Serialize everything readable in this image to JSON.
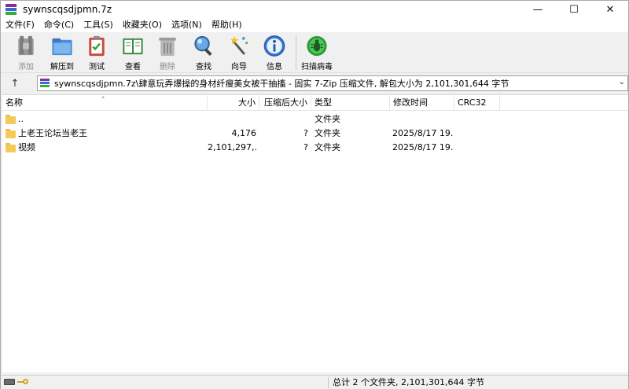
{
  "window": {
    "title": "sywnscqsdjpmn.7z",
    "minimize_glyph": "—",
    "maximize_glyph": "☐",
    "close_glyph": "✕"
  },
  "menu": [
    "文件(F)",
    "命令(C)",
    "工具(S)",
    "收藏夹(O)",
    "选项(N)",
    "帮助(H)"
  ],
  "toolbar": {
    "add": "添加",
    "extract": "解压到",
    "test": "测试",
    "view": "查看",
    "delete": "删除",
    "find": "查找",
    "wizard": "向导",
    "info": "信息",
    "scan": "扫描病毒"
  },
  "address": {
    "up_glyph": "↑",
    "path": "sywnscqsdjpmn.7z\\肆意玩弄爆操的身材纤瘦美女被干抽搐 - 固实 7-Zip 压缩文件, 解包大小为 2,101,301,644 字节",
    "dropdown_glyph": "⌄"
  },
  "columns": {
    "name": "名称",
    "size": "大小",
    "packed": "压缩后大小",
    "type": "类型",
    "modified": "修改时间",
    "crc": "CRC32"
  },
  "sort_caret": "˄",
  "rows": [
    {
      "name": "..",
      "size": "",
      "packed": "",
      "type": "文件夹",
      "modified": ""
    },
    {
      "name": "上老王论坛当老王",
      "size": "4,176",
      "packed": "?",
      "type": "文件夹",
      "modified": "2025/8/17 19..."
    },
    {
      "name": "视频",
      "size": "2,101,297,...",
      "packed": "?",
      "type": "文件夹",
      "modified": "2025/8/17 19..."
    }
  ],
  "status": {
    "summary": "总计 2 个文件夹, 2,101,301,644 字节"
  }
}
